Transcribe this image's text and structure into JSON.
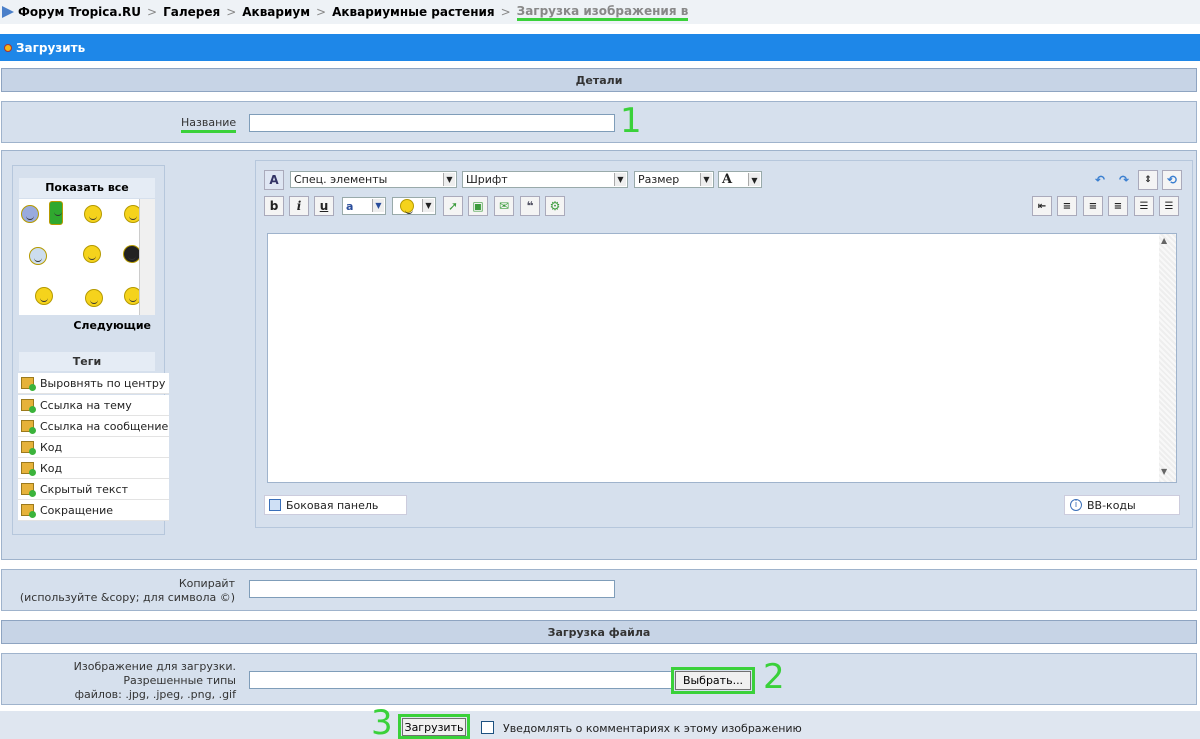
{
  "breadcrumb": {
    "items": [
      "Форум Tropica.RU",
      "Галерея",
      "Аквариум",
      "Аквариумные растения"
    ],
    "current": "Загрузка изображения в",
    "separator": ">"
  },
  "bar": {
    "title": "Загрузить"
  },
  "sections": {
    "details": "Детали",
    "file_upload": "Загрузка файла"
  },
  "title_field": {
    "label": "Название",
    "value": "",
    "marker": "1"
  },
  "smilies": {
    "show_all": "Показать все",
    "next": "Следующие"
  },
  "tags": {
    "header": "Теги",
    "items": [
      "Выровнять по центру",
      "Ссылка на тему",
      "Ссылка на сообщение",
      "Код",
      "Код",
      "Скрытый текст",
      "Сокращение"
    ]
  },
  "editor": {
    "special_elements": "Спец. элементы",
    "font": "Шрифт",
    "size": "Размер",
    "font_color_glyph": "A",
    "bold": "b",
    "italic": "i",
    "underline": "u",
    "side_panel": "Боковая панель",
    "bbcodes": "BB-коды",
    "content": ""
  },
  "copyright": {
    "label_line1": "Копирайт",
    "label_line2": "(используйте &copy; для символа ©)",
    "value": ""
  },
  "file": {
    "label_line1": "Изображение для загрузки.",
    "label_line2": "Разрешенные типы",
    "label_line3": "файлов: .jpg, .jpeg, .png, .gif",
    "value": "",
    "browse": "Выбрать...",
    "marker": "2"
  },
  "submit": {
    "label": "Загрузить",
    "marker": "3",
    "notify_label": "Уведомлять о комментариях к этому изображению",
    "notify_checked": false
  },
  "colors": {
    "accent": "#1e87e8",
    "highlight": "#3ad13a"
  }
}
